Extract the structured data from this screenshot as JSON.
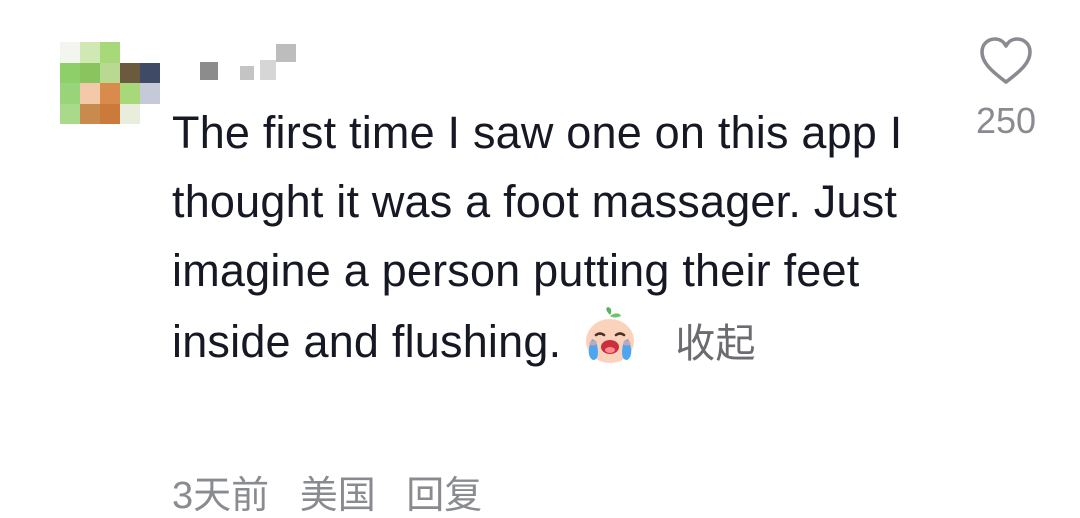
{
  "comment": {
    "text": "The first time I saw one on this app I thought it was a foot massager. Just imagine a person putting their feet inside and flushing.",
    "emoji": "crying-laughing-peach-emoji",
    "collapse_label": "收起",
    "meta": {
      "time": "3天前",
      "location": "美国",
      "reply_label": "回复"
    },
    "like": {
      "icon": "heart-outline-icon",
      "count": "250"
    }
  },
  "colors": {
    "text": "#161823",
    "secondary": "#8a8b90"
  }
}
